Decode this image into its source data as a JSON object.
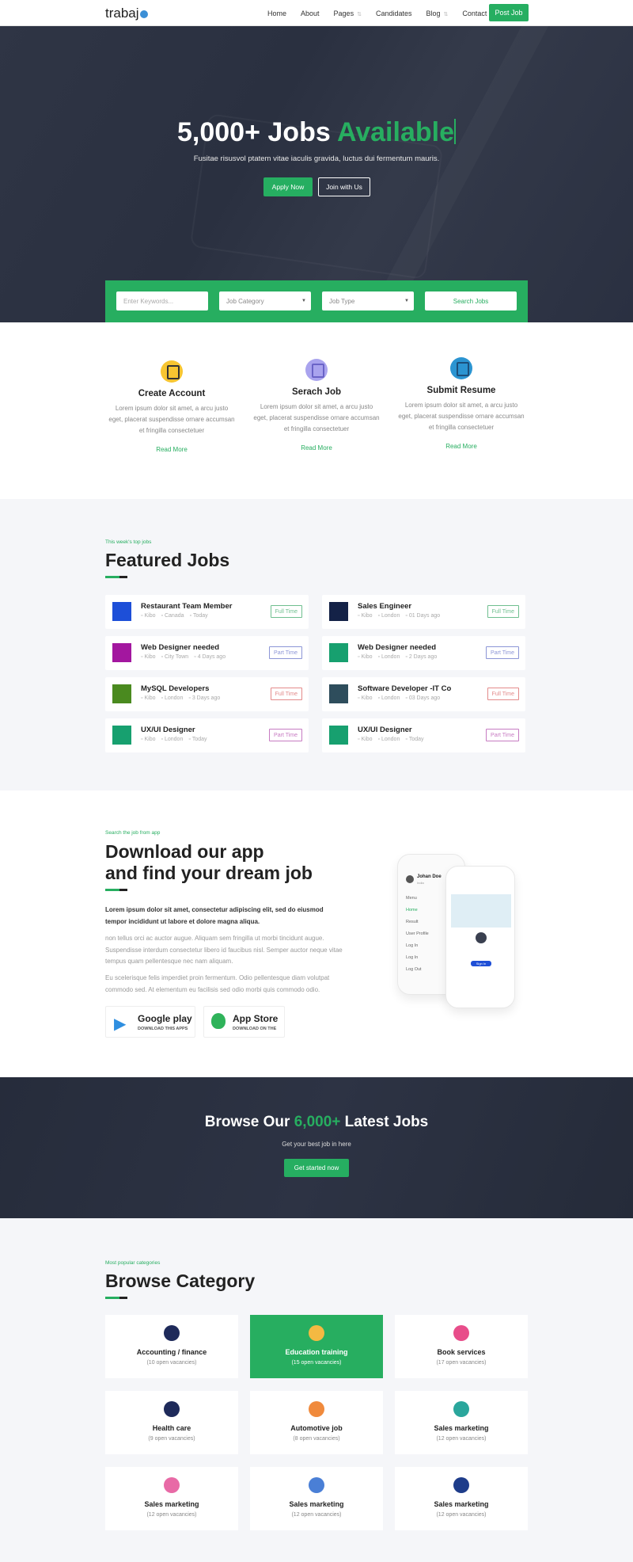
{
  "nav": {
    "logo": "trabaj",
    "links": [
      "Home",
      "About",
      "Pages",
      "Candidates",
      "Blog",
      "Contact"
    ],
    "post_job": "Post Job"
  },
  "hero": {
    "title_white": "5,000+ Jobs",
    "title_green": "Available",
    "subtitle": "Fusitae risusvol ptatem vitae iaculis gravida, luctus dui fermentum mauris.",
    "apply": "Apply Now",
    "join": "Join with Us"
  },
  "search": {
    "keyword_placeholder": "Enter Keywords...",
    "category": "Job Category",
    "type": "Job Type",
    "button": "Search Jobs"
  },
  "features": [
    {
      "title": "Create Account",
      "text": "Lorem ipsum dolor sit amet, a arcu justo eget, placerat suspendisse ornare accumsan et fringilla consectetuer",
      "link": "Read More",
      "icon": "lock-icon",
      "color": "#f7c531"
    },
    {
      "title": "Serach Job",
      "text": "Lorem ipsum dolor sit amet, a arcu justo eget, placerat suspendisse ornare accumsan et fringilla consectetuer",
      "link": "Read More",
      "icon": "search-document-icon",
      "color": "#a9a3ee"
    },
    {
      "title": "Submit Resume",
      "text": "Lorem ipsum dolor sit amet, a arcu justo eget, placerat suspendisse ornare accumsan et fringilla consectetuer",
      "link": "Read More",
      "icon": "resume-icon",
      "color": "#2b94d1"
    }
  ],
  "featured": {
    "kicker": "This week's top jobs",
    "title": "Featured Jobs",
    "jobs": [
      {
        "title": "Restaurant Team Member",
        "company": "Kibo",
        "location": "Canada",
        "time": "Today",
        "type": "Full Time",
        "logo_color": "#1d4fd8",
        "badge_color": "#6fbf8f"
      },
      {
        "title": "Sales Engineer",
        "company": "Kibo",
        "location": "London",
        "time": "01 Days ago",
        "type": "Full Time",
        "logo_color": "#142247",
        "badge_color": "#6fbf8f"
      },
      {
        "title": "Web Designer needed",
        "company": "Kibo",
        "location": "City Town",
        "time": "4 Days ago",
        "type": "Part Time",
        "logo_color": "#a3179f",
        "badge_color": "#8c95d6"
      },
      {
        "title": "Web Designer needed",
        "company": "Kibo",
        "location": "London",
        "time": "2 Days ago",
        "type": "Part Time",
        "logo_color": "#17a06f",
        "badge_color": "#8c95d6"
      },
      {
        "title": "MySQL Developers",
        "company": "Kibo",
        "location": "London",
        "time": "3 Days ago",
        "type": "Full Time",
        "logo_color": "#4a8a1f",
        "badge_color": "#e38a8a"
      },
      {
        "title": "Software Developer -IT Co",
        "company": "Kibo",
        "location": "London",
        "time": "03 Days ago",
        "type": "Full Time",
        "logo_color": "#2e4d5c",
        "badge_color": "#e38a8a"
      },
      {
        "title": "UX/UI Designer",
        "company": "Kibo",
        "location": "London",
        "time": "Today",
        "type": "Part Time",
        "logo_color": "#17a06f",
        "badge_color": "#c77bc2"
      },
      {
        "title": "UX/UI Designer",
        "company": "Kibo",
        "location": "London",
        "time": "Today",
        "type": "Part Time",
        "logo_color": "#17a06f",
        "badge_color": "#c77bc2"
      }
    ]
  },
  "app": {
    "kicker": "Search the job from app",
    "title_line1": "Download our app",
    "title_line2": "and find your dream job",
    "lead": "Lorem ipsum dolor sit amet, consectetur adipiscing elit, sed do eiusmod tempor incididunt ut labore et dolore magna aliqua.",
    "p1": "non tellus orci ac auctor augue. Aliquam sem fringilla ut morbi tincidunt augue. Suspendisse interdum consectetur libero id faucibus nisl. Semper auctor neque vitae tempus quam pellentesque nec nam aliquam.",
    "p2": "Eu scelerisque felis imperdiet proin fermentum. Odio pellentesque diam volutpat commodo sed. At elementum eu facilisis sed odio morbi quis commodo odio.",
    "google": {
      "name": "Google play",
      "sub": "DOWNLOAD THIS APPS"
    },
    "apple": {
      "name": "App Store",
      "sub": "DOWNLOAD ON THE"
    },
    "phone": {
      "user": "Johan Doe",
      "country": "India",
      "menu": [
        "Menu",
        "Home",
        "Result",
        "User Profile",
        "Log In",
        "Log In",
        "Log Out"
      ],
      "signin": "Sign In"
    }
  },
  "browse": {
    "title_a": "Browse Our",
    "title_green": "6,000+",
    "title_b": "Latest Jobs",
    "subtitle": "Get your best job in here",
    "button": "Get started now"
  },
  "categories": {
    "kicker": "Most popular categories",
    "title": "Browse Category",
    "items": [
      {
        "name": "Accounting / finance",
        "count": "(10 open vacancies)",
        "color": "#1e2a5a",
        "active": false
      },
      {
        "name": "Education training",
        "count": "(15 open vacancies)",
        "color": "#f4b942",
        "active": true
      },
      {
        "name": "Book services",
        "count": "(17 open vacancies)",
        "color": "#e84d8a",
        "active": false
      },
      {
        "name": "Health care",
        "count": "(9 open vacancies)",
        "color": "#1e2a5a",
        "active": false
      },
      {
        "name": "Automotive job",
        "count": "(8 open vacancies)",
        "color": "#f08a3c",
        "active": false
      },
      {
        "name": "Sales marketing",
        "count": "(12 open vacancies)",
        "color": "#2aa69c",
        "active": false
      },
      {
        "name": "Sales marketing",
        "count": "(12 open vacancies)",
        "color": "#e86aa6",
        "active": false
      },
      {
        "name": "Sales marketing",
        "count": "(12 open vacancies)",
        "color": "#4a7fd6",
        "active": false
      },
      {
        "name": "Sales marketing",
        "count": "(12 open vacancies)",
        "color": "#1e3c8a",
        "active": false
      }
    ]
  }
}
